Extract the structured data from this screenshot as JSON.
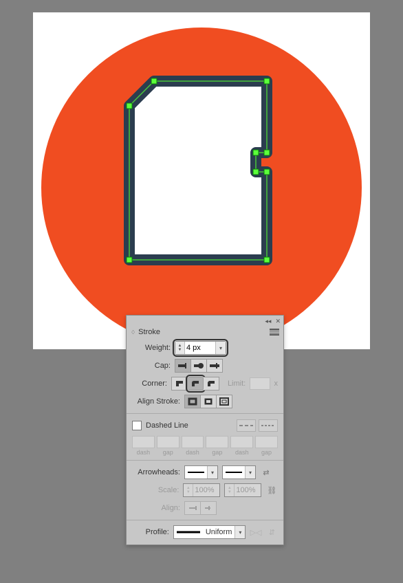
{
  "panel": {
    "title": "Stroke",
    "weight_label": "Weight:",
    "weight_value": "4 px",
    "cap_label": "Cap:",
    "corner_label": "Corner:",
    "limit_label": "Limit:",
    "limit_value": "",
    "limit_unit": "x",
    "align_label": "Align Stroke:",
    "dashed_label": "Dashed Line",
    "dash_labels": [
      "dash",
      "gap",
      "dash",
      "gap",
      "dash",
      "gap"
    ],
    "arrow_label": "Arrowheads:",
    "scale_label": "Scale:",
    "scale_start": "100%",
    "scale_end": "100%",
    "align_arrow_label": "Align:",
    "profile_label": "Profile:",
    "profile_value": "Uniform",
    "cap_selected": 0,
    "corner_selected": 1,
    "align_selected": 0
  },
  "colors": {
    "canvas_bg": "#808080",
    "artboard_bg": "#ffffff",
    "circle": "#f04d21",
    "shape_fill": "#ffffff",
    "shape_stroke": "#2b3d4f",
    "path_edge": "#49c53a",
    "anchor_fill": "#5cff3b",
    "panel_bg": "#c7c7c7"
  }
}
